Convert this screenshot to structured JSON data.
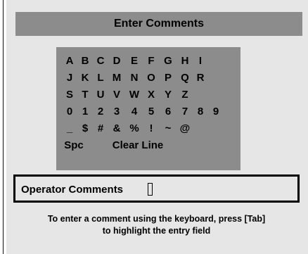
{
  "dialog": {
    "title": "Enter Comments"
  },
  "keypad": {
    "rows": [
      [
        "A",
        "B",
        "C",
        "D",
        "E",
        "F",
        "G",
        "H",
        "I"
      ],
      [
        "J",
        "K",
        "L",
        "M",
        "N",
        "O",
        "P",
        "Q",
        "R"
      ],
      [
        "S",
        "T",
        "U",
        "V",
        "W",
        "X",
        "Y",
        "Z"
      ],
      [
        "0",
        "1",
        "2",
        "3",
        "4",
        "5",
        "6",
        "7",
        "8",
        "9"
      ],
      [
        "_",
        "$",
        "#",
        "&",
        "%",
        "!",
        "~",
        "@"
      ]
    ],
    "space_label": "Spc",
    "clear_label": "Clear Line"
  },
  "comment_field": {
    "value": "Operator Comments"
  },
  "hint": {
    "line1": "To enter a comment using the keyboard, press [Tab]",
    "line2": "to highlight the entry field"
  },
  "colors": {
    "panel_background": "#e6e6e6",
    "bar_gray": "#8c8c8c",
    "text": "#000000"
  }
}
